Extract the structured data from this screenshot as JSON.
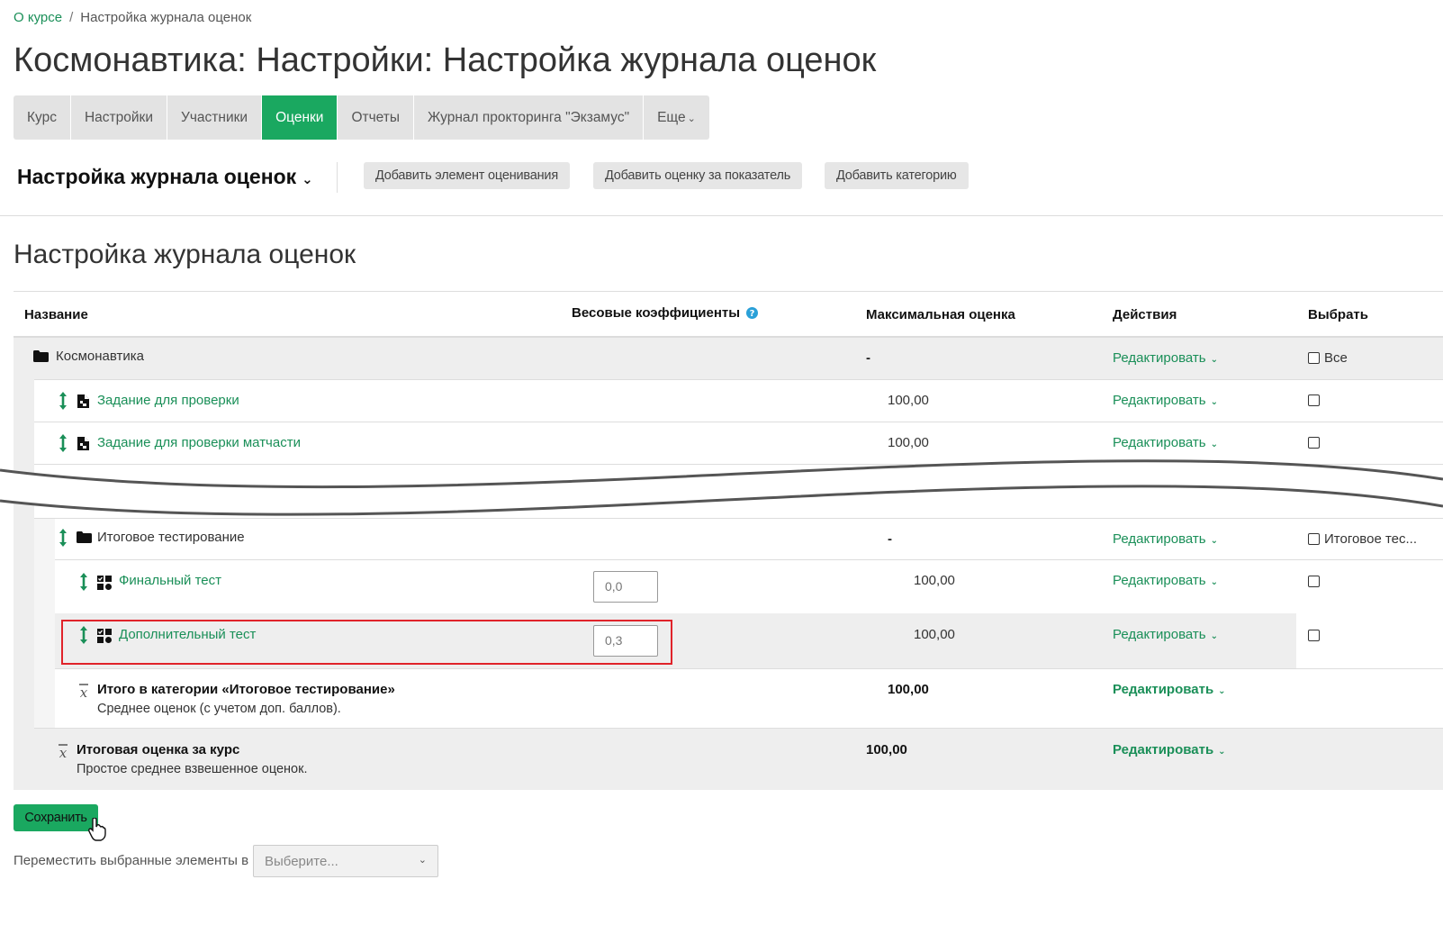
{
  "breadcrumb": {
    "course": "О курсе",
    "separator": "/",
    "current": "Настройка журнала оценок"
  },
  "page_title": "Космонавтика: Настройки: Настройка журнала оценок",
  "tabs": [
    {
      "label": "Курс"
    },
    {
      "label": "Настройки"
    },
    {
      "label": "Участники"
    },
    {
      "label": "Оценки",
      "active": true
    },
    {
      "label": "Отчеты"
    },
    {
      "label": "Журнал прокторинга \"Экзамус\""
    },
    {
      "label": "Еще"
    }
  ],
  "toolbar": {
    "title": "Настройка журнала оценок",
    "add_item": "Добавить элемент оценивания",
    "add_outcome": "Добавить оценку за показатель",
    "add_category": "Добавить категорию"
  },
  "section_title": "Настройка журнала оценок",
  "table": {
    "headers": {
      "name": "Название",
      "weights": "Весовые коэффициенты",
      "max": "Максимальная оценка",
      "actions": "Действия",
      "select": "Выбрать"
    },
    "edit_label": "Редактировать",
    "rows": {
      "course": {
        "name": "Космонавтика",
        "max": "-",
        "select": "Все"
      },
      "item1": {
        "name": "Задание для проверки",
        "max": "100,00"
      },
      "item2": {
        "name": "Задание для проверки матчасти",
        "max": "100,00"
      },
      "category": {
        "name": "Итоговое тестирование",
        "max": "-",
        "select": "Итоговое тес..."
      },
      "quiz1": {
        "name": "Финальный тест",
        "weight": "0,0",
        "max": "100,00"
      },
      "quiz2": {
        "name": "Дополнительный тест",
        "weight": "0,3",
        "max": "100,00"
      },
      "cat_total": {
        "name": "Итого в категории «Итоговое тестирование»",
        "desc": "Среднее оценок (с учетом доп. баллов).",
        "max": "100,00"
      },
      "course_total": {
        "name": "Итоговая оценка за курс",
        "desc": "Простое среднее взвешенное оценок.",
        "max": "100,00"
      }
    }
  },
  "save_label": "Сохранить",
  "move": {
    "label": "Переместить выбранные элементы в",
    "placeholder": "Выберите..."
  },
  "colors": {
    "accent": "#1aa860",
    "link": "#1a8f58",
    "highlight": "#e0232a"
  },
  "icons": [
    "move-icon",
    "assignment-icon",
    "folder-icon",
    "quiz-icon",
    "sum-icon",
    "help-icon",
    "chevron-down-icon",
    "hand-cursor-icon"
  ]
}
